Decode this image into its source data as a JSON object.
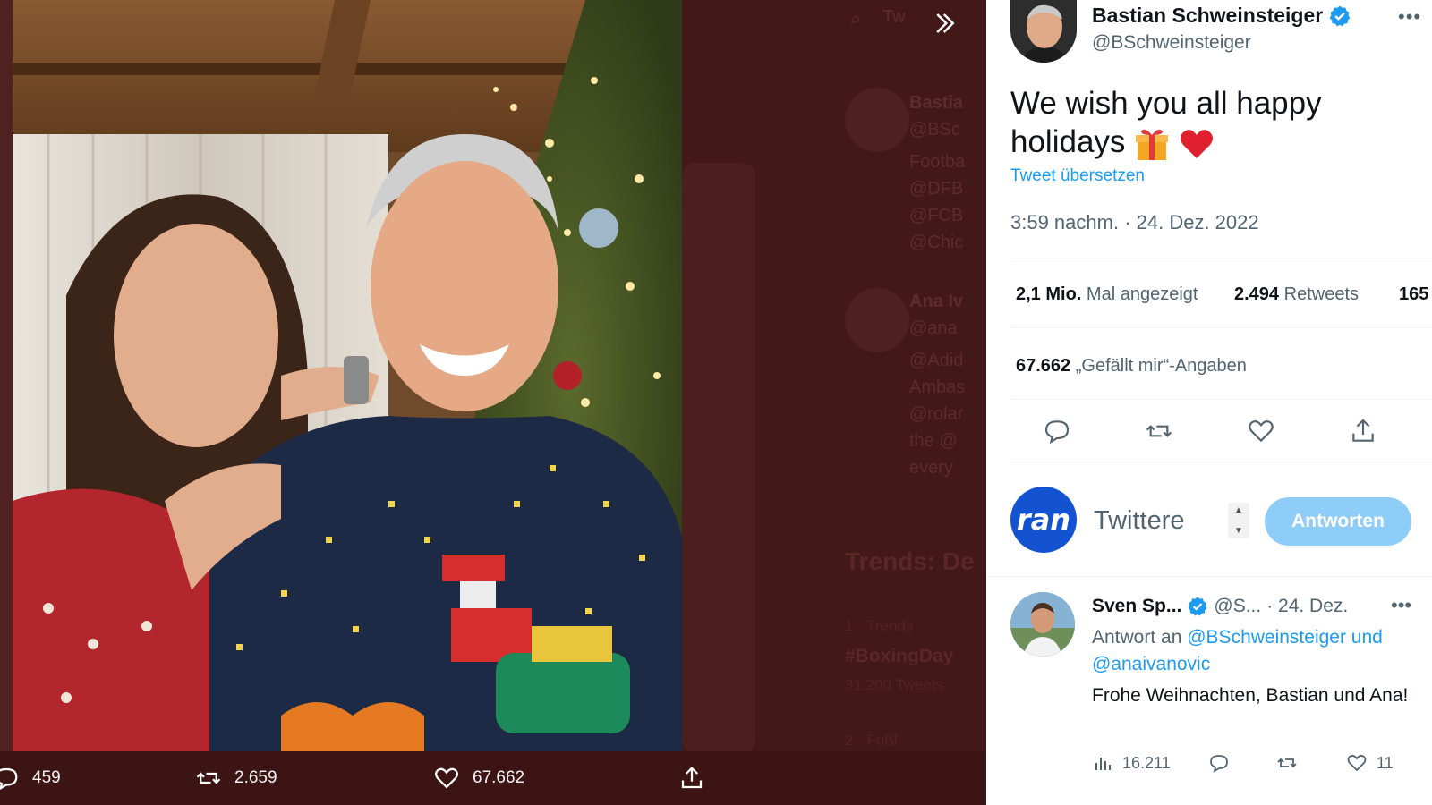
{
  "media_viewer": {
    "background_ghost": {
      "search_text": "Tw",
      "profile_name": "Bastia",
      "profile_handle": "@BSc",
      "bio_lines": [
        "Footba",
        "@DFB",
        "@FCB",
        "@Chic"
      ],
      "profile2_name": "Ana Iv",
      "profile2_handle": "@ana",
      "bio2_lines": [
        "@Adid",
        "Ambas",
        "@rolar",
        "the @",
        "every"
      ],
      "trends_title": "Trends: De",
      "trend_meta": "1 · Trends",
      "trend_tag": "#BoxingDay",
      "trend_count": "31.200 Tweets",
      "trend2_meta": "2 · Fußl"
    },
    "actions": {
      "replies": "459",
      "retweets": "2.659",
      "likes": "67.662"
    }
  },
  "tweet": {
    "author_name": "Bastian Schweinsteiger",
    "author_handle": "@BSchweinsteiger",
    "text": "We wish you all happy holidays",
    "translate_label": "Tweet übersetzen",
    "timestamp": "3:59 nachm. · 24. Dez. 2022",
    "stats": {
      "views_value": "2,1 Mio.",
      "views_label": "Mal angezeigt",
      "retweets_value": "2.494",
      "retweets_label": "Retweets",
      "quotes_value": "165",
      "likes_value": "67.662",
      "likes_label": "„Gefällt mir“-Angaben"
    }
  },
  "reply_composer": {
    "avatar_label": "ran",
    "placeholder": "Twittere",
    "button_label": "Antworten"
  },
  "reply": {
    "name": "Sven Sp...",
    "handle": "@S...",
    "date": "· 24. Dez.",
    "reply_prefix": "Antwort an",
    "reply_to": "@BSchweinsteiger und @anaivanovic",
    "body": "Frohe Weihnachten, Bastian und Ana!",
    "views": "16.211",
    "likes": "11"
  },
  "colors": {
    "accent": "#1d9bf0",
    "reply_button": "#8ecdf7",
    "overlay": "#431818"
  }
}
